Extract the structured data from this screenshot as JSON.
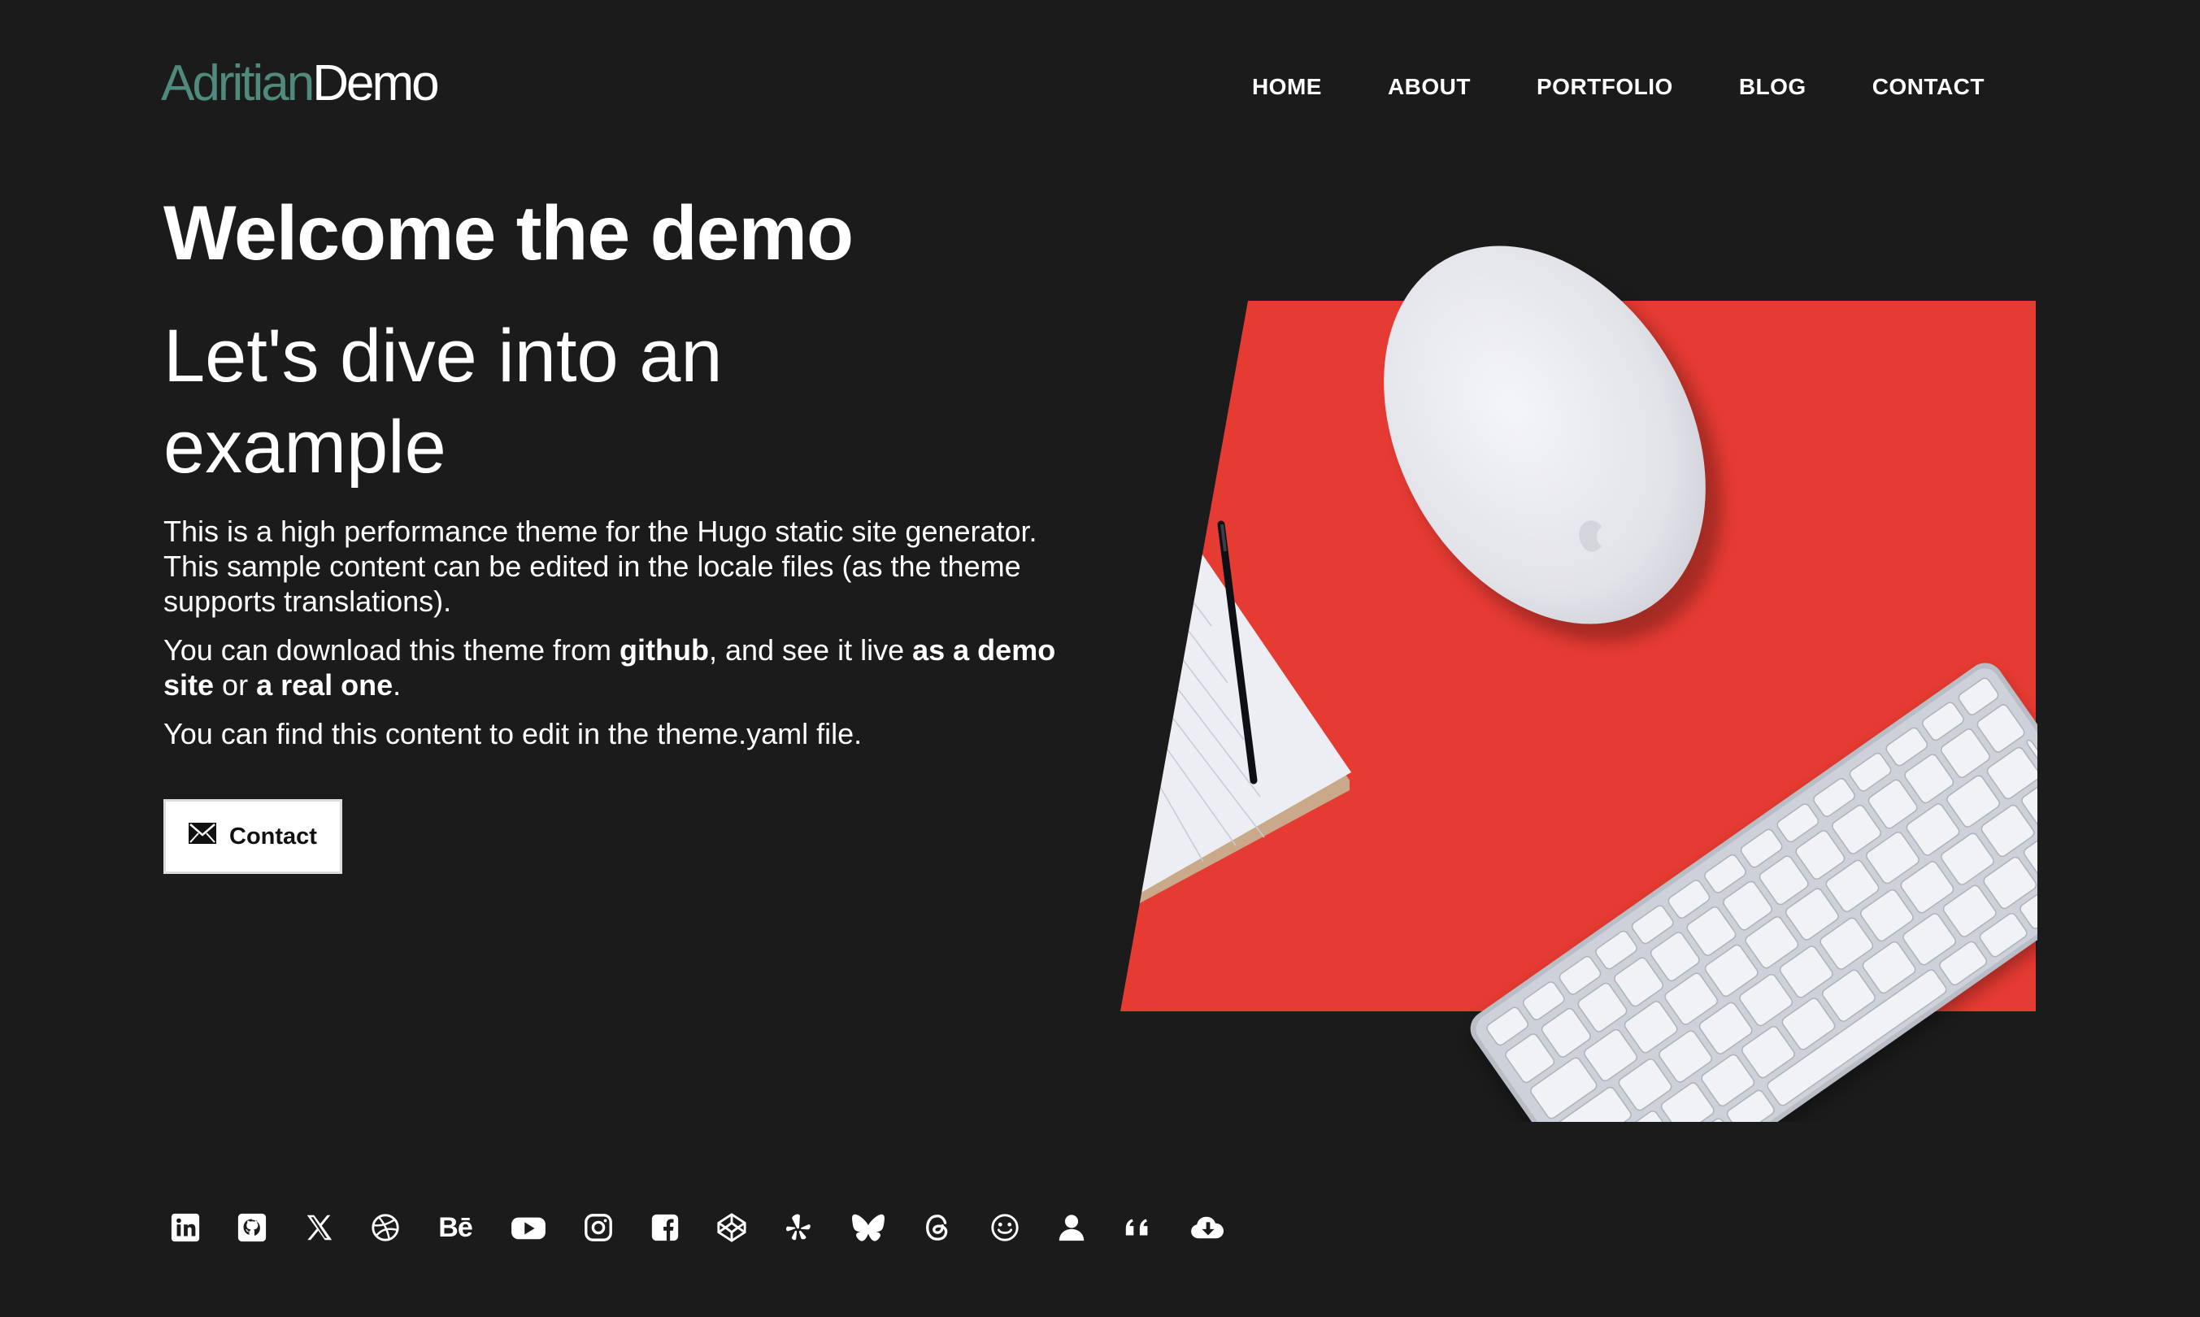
{
  "header": {
    "logo_brand": "Adritian",
    "logo_suffix": "Demo",
    "nav": [
      "HOME",
      "ABOUT",
      "PORTFOLIO",
      "BLOG",
      "CONTACT"
    ]
  },
  "hero": {
    "title": "Welcome the demo",
    "subtitle": "Let's dive into an example",
    "paragraph1": "This is a high performance theme for the Hugo static site generator. This sample content can be edited in the locale files (as the theme supports translations).",
    "paragraph2": {
      "t1": "You can download this theme from ",
      "link_github": "github",
      "t2": ", and see it live ",
      "link_demo": "as a demo site",
      "t3": " or ",
      "link_real": "a real one",
      "t4": "."
    },
    "paragraph3": "You can find this content to edit in the theme.yaml file.",
    "contact_button": "Contact"
  },
  "socials": {
    "icons": [
      "linkedin-icon",
      "github-icon",
      "x-icon",
      "dribbble-icon",
      "behance-icon",
      "youtube-icon",
      "instagram-icon",
      "facebook-icon",
      "codepen-icon",
      "yelp-icon",
      "bluesky-icon",
      "threads-icon",
      "smile-icon",
      "user-icon",
      "quote-icon",
      "cloud-download-icon"
    ],
    "behance_text": "Bē"
  },
  "colors": {
    "background": "#1b1b1b",
    "brand": "#4f8a7c",
    "hero_image_red": "#e63b32"
  }
}
